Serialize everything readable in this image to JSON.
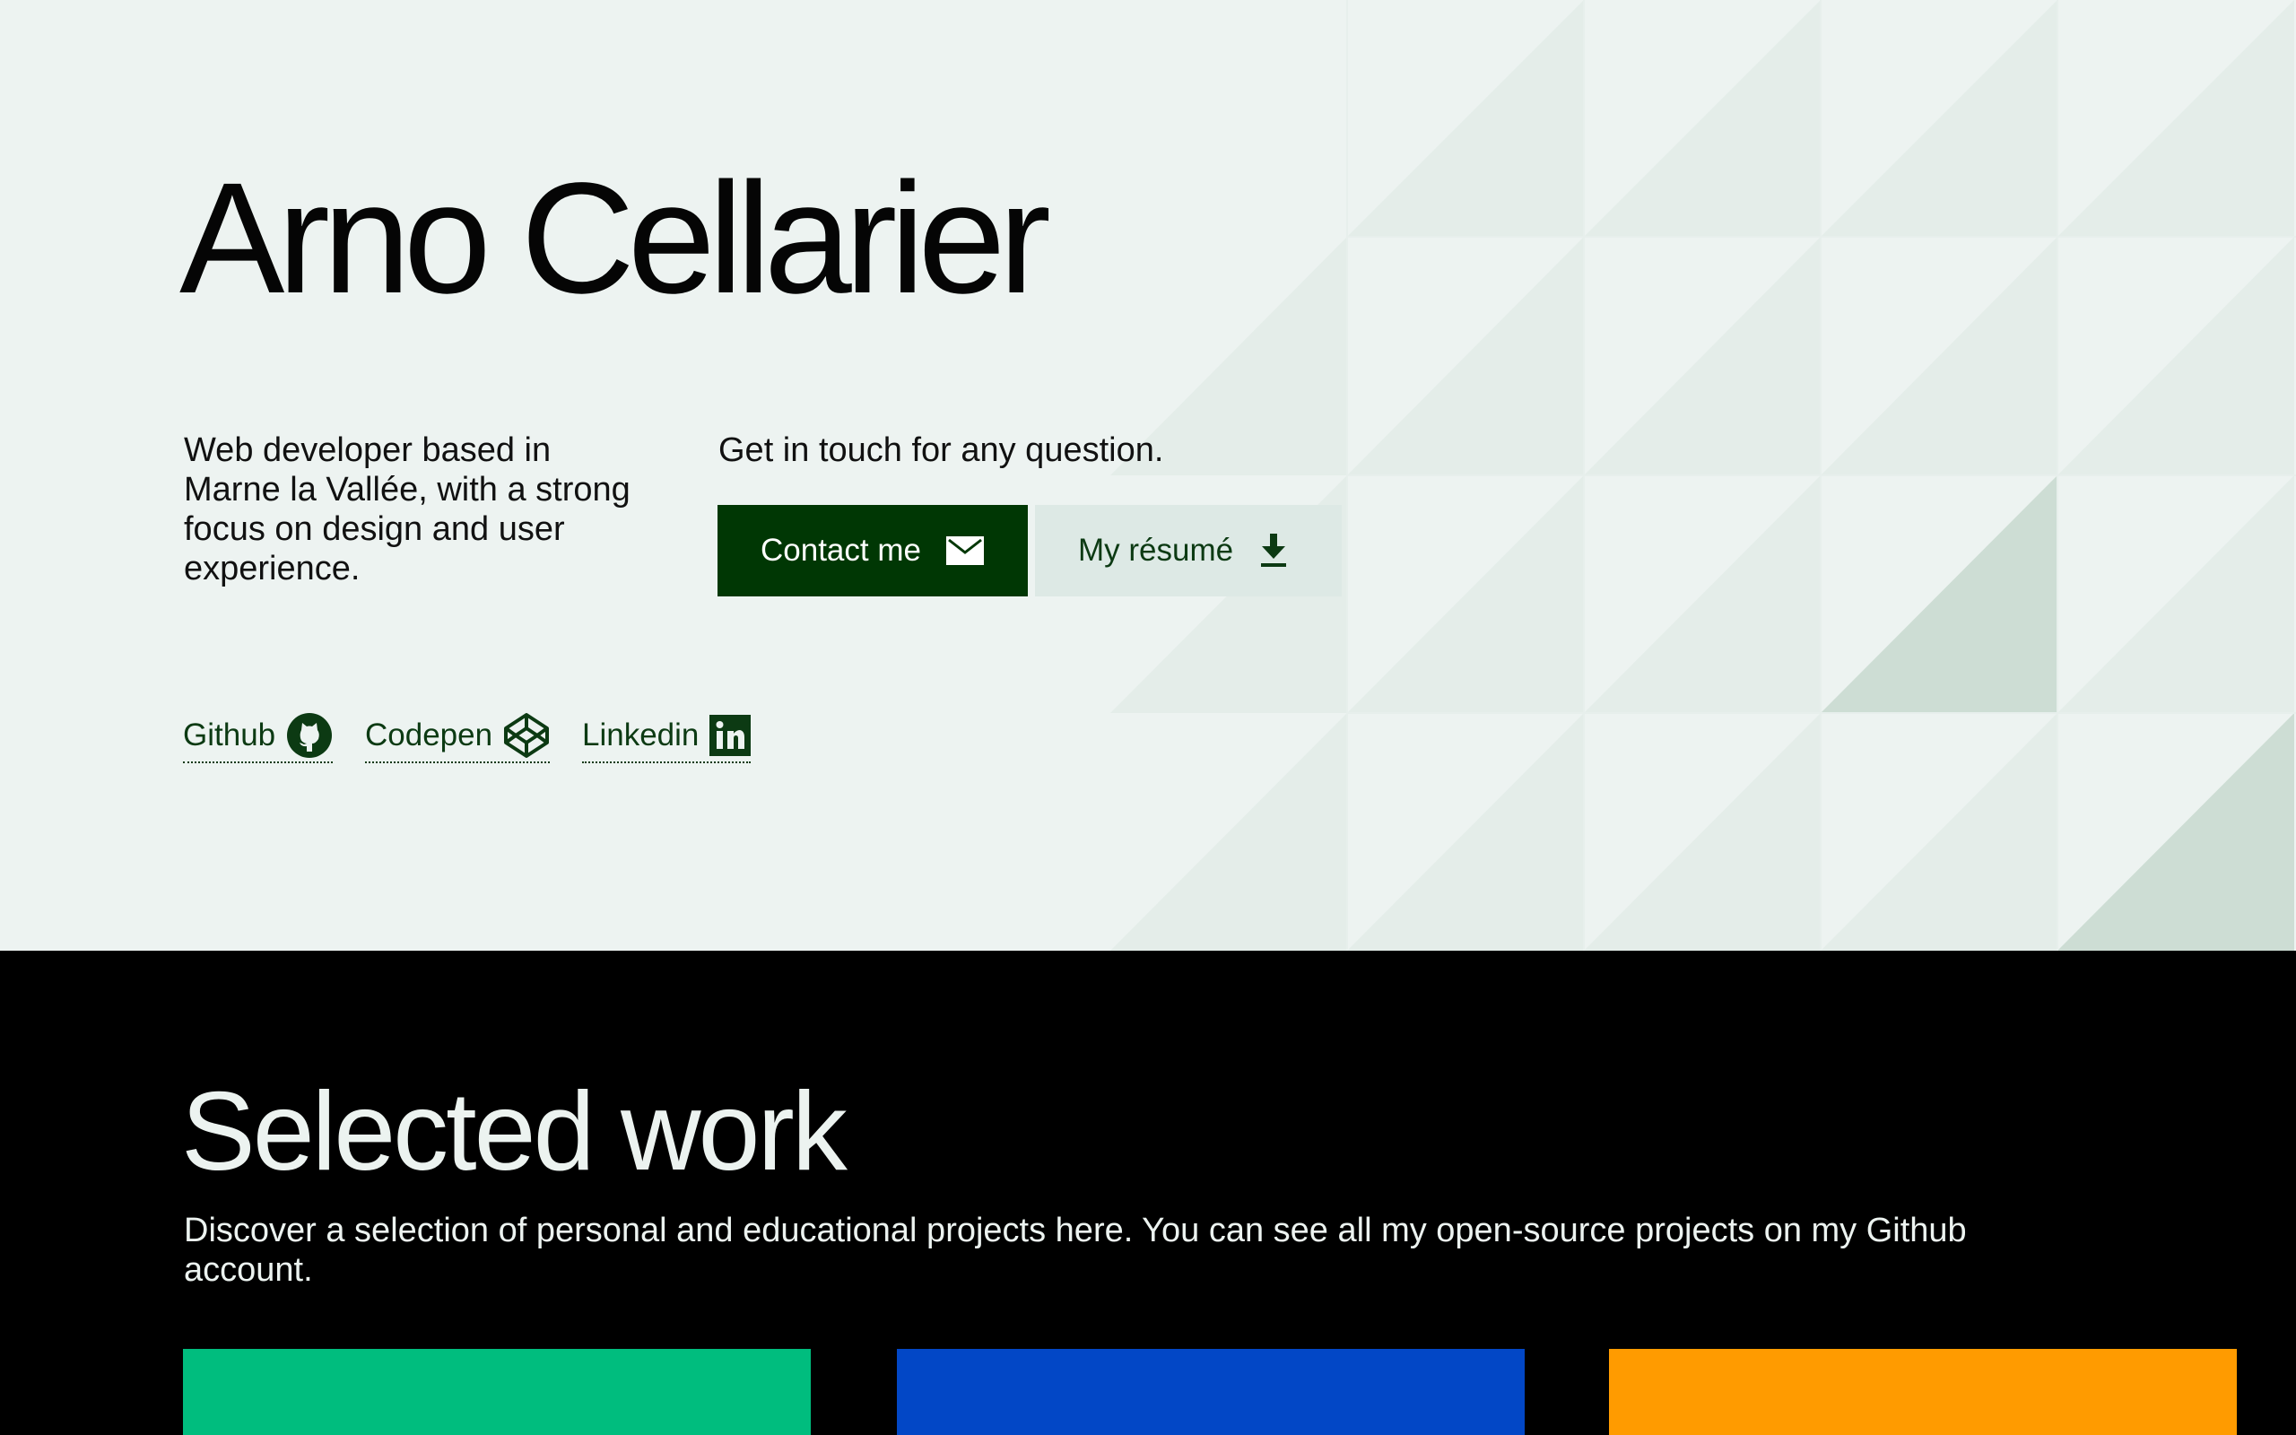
{
  "hero": {
    "name": "Arno Cellarier",
    "description": "Web developer based in Marne la Vallée, with a strong focus on design and user experience.",
    "cta_text": "Get in touch for any question.",
    "contact_button": {
      "label": "Contact me",
      "icon": "mail-icon"
    },
    "resume_button": {
      "label": "My résumé",
      "icon": "download-icon"
    },
    "social_links": [
      {
        "label": "Github",
        "icon": "github-icon"
      },
      {
        "label": "Codepen",
        "icon": "codepen-icon"
      },
      {
        "label": "Linkedin",
        "icon": "linkedin-icon"
      }
    ]
  },
  "work": {
    "title": "Selected work",
    "description": "Discover a selection of personal and educational projects here. You can see all my open-source projects on my Github account.",
    "cards": [
      {
        "color": "#00bd7e"
      },
      {
        "color": "#0247c6"
      },
      {
        "color": "#ff9b00"
      }
    ]
  },
  "colors": {
    "hero_background": "#edf3f1",
    "accent_dark_green": "#003704",
    "secondary_button": "#dde9e5",
    "link_green": "#0c3a13",
    "work_background": "#000000"
  }
}
